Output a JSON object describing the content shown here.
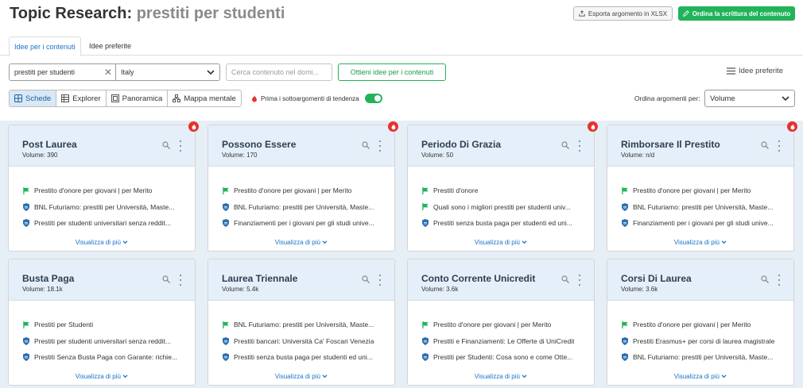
{
  "header": {
    "title_prefix": "Topic Research:",
    "title_keyword": "prestiti per studenti",
    "export_label": "Esporta argomento in XLSX",
    "order_label": "Ordina la scrittura del contenuto"
  },
  "tabs": [
    {
      "label": "Idee per i contenuti",
      "active": true
    },
    {
      "label": "Idee preferite",
      "active": false
    }
  ],
  "search": {
    "keyword_value": "prestiti per studenti",
    "country_value": "Italy",
    "domain_placeholder": "Cerca contenuto nel domi...",
    "get_ideas_label": "Ottieni idee per i contenuti",
    "favorites_label": "Idee preferite"
  },
  "views": [
    {
      "label": "Schede",
      "icon": "cards-icon",
      "active": true
    },
    {
      "label": "Explorer",
      "icon": "table-icon",
      "active": false
    },
    {
      "label": "Panoramica",
      "icon": "overview-icon",
      "active": false
    },
    {
      "label": "Mappa mentale",
      "icon": "mindmap-icon",
      "active": false
    }
  ],
  "trend_toggle": {
    "label": "Prima i sottoargomenti di tendenza",
    "on": true
  },
  "sort": {
    "label": "Ordina argomenti per:",
    "value": "Volume"
  },
  "more_label": "Visualizza di più",
  "colors": {
    "accent_blue": "#1a73c8",
    "green": "#21b35a",
    "trend_red": "#e5322d",
    "card_header": "#e5eff9",
    "board_bg": "#e6eef6"
  },
  "cards": [
    {
      "title": "Post Laurea",
      "volume": "Volume: 390",
      "trending": true,
      "items": [
        {
          "icon": "green-flag-icon",
          "text": "Prestito d'onore per giovani | per Merito"
        },
        {
          "icon": "blue-shield-icon",
          "text": "BNL Futuriamo: prestiti per Università, Maste..."
        },
        {
          "icon": "blue-shield-icon",
          "text": "Prestiti per studenti universitari senza reddit..."
        }
      ]
    },
    {
      "title": "Possono Essere",
      "volume": "Volume: 170",
      "trending": true,
      "items": [
        {
          "icon": "green-flag-icon",
          "text": "Prestito d'onore per giovani | per Merito"
        },
        {
          "icon": "blue-shield-icon",
          "text": "BNL Futuriamo: prestiti per Università, Maste..."
        },
        {
          "icon": "blue-shield-icon",
          "text": "Finanziamenti per i giovani per gli studi unive..."
        }
      ]
    },
    {
      "title": "Periodo Di Grazia",
      "volume": "Volume: 50",
      "trending": true,
      "items": [
        {
          "icon": "green-flag-icon",
          "text": "Prestiti d'onore"
        },
        {
          "icon": "green-flag-icon",
          "text": "Quali sono i migliori prestiti per studenti univ..."
        },
        {
          "icon": "blue-shield-icon",
          "text": "Prestiti senza busta paga per studenti ed uni..."
        }
      ]
    },
    {
      "title": "Rimborsare Il Prestito",
      "volume": "Volume: n/d",
      "trending": true,
      "items": [
        {
          "icon": "green-flag-icon",
          "text": "Prestito d'onore per giovani | per Merito"
        },
        {
          "icon": "blue-shield-icon",
          "text": "BNL Futuriamo: prestiti per Università, Maste..."
        },
        {
          "icon": "blue-shield-icon",
          "text": "Finanziamenti per i giovani per gli studi unive..."
        }
      ]
    },
    {
      "title": "Busta Paga",
      "volume": "Volume: 18.1k",
      "trending": false,
      "items": [
        {
          "icon": "green-flag-icon",
          "text": "Prestiti per Studenti"
        },
        {
          "icon": "blue-shield-icon",
          "text": "Prestiti per studenti universitari senza reddit..."
        },
        {
          "icon": "blue-shield-icon",
          "text": "Prestiti Senza Busta Paga con Garante: richie..."
        }
      ]
    },
    {
      "title": "Laurea Triennale",
      "volume": "Volume: 5.4k",
      "trending": false,
      "items": [
        {
          "icon": "green-flag-icon",
          "text": "BNL Futuriamo: prestiti per Università, Maste..."
        },
        {
          "icon": "blue-shield-icon",
          "text": "Prestiti bancari: Università Ca' Foscari Venezia"
        },
        {
          "icon": "blue-shield-icon",
          "text": "Prestiti senza busta paga per studenti ed uni..."
        }
      ]
    },
    {
      "title": "Conto Corrente Unicredit",
      "volume": "Volume: 3.6k",
      "trending": false,
      "items": [
        {
          "icon": "green-flag-icon",
          "text": "Prestito d'onore per giovani | per Merito"
        },
        {
          "icon": "blue-shield-icon",
          "text": "Prestiti e Finanziamenti: Le Offerte di UniCredit"
        },
        {
          "icon": "blue-shield-icon",
          "text": "Prestiti per Studenti: Cosa sono e come Otte..."
        }
      ]
    },
    {
      "title": "Corsi Di Laurea",
      "volume": "Volume: 3.6k",
      "trending": false,
      "items": [
        {
          "icon": "green-flag-icon",
          "text": "Prestito d'onore per giovani | per Merito"
        },
        {
          "icon": "blue-shield-icon",
          "text": "Prestiti Erasmus+ per corsi di laurea magistrale"
        },
        {
          "icon": "blue-shield-icon",
          "text": "BNL Futuriamo: prestiti per Università, Maste..."
        }
      ]
    }
  ]
}
